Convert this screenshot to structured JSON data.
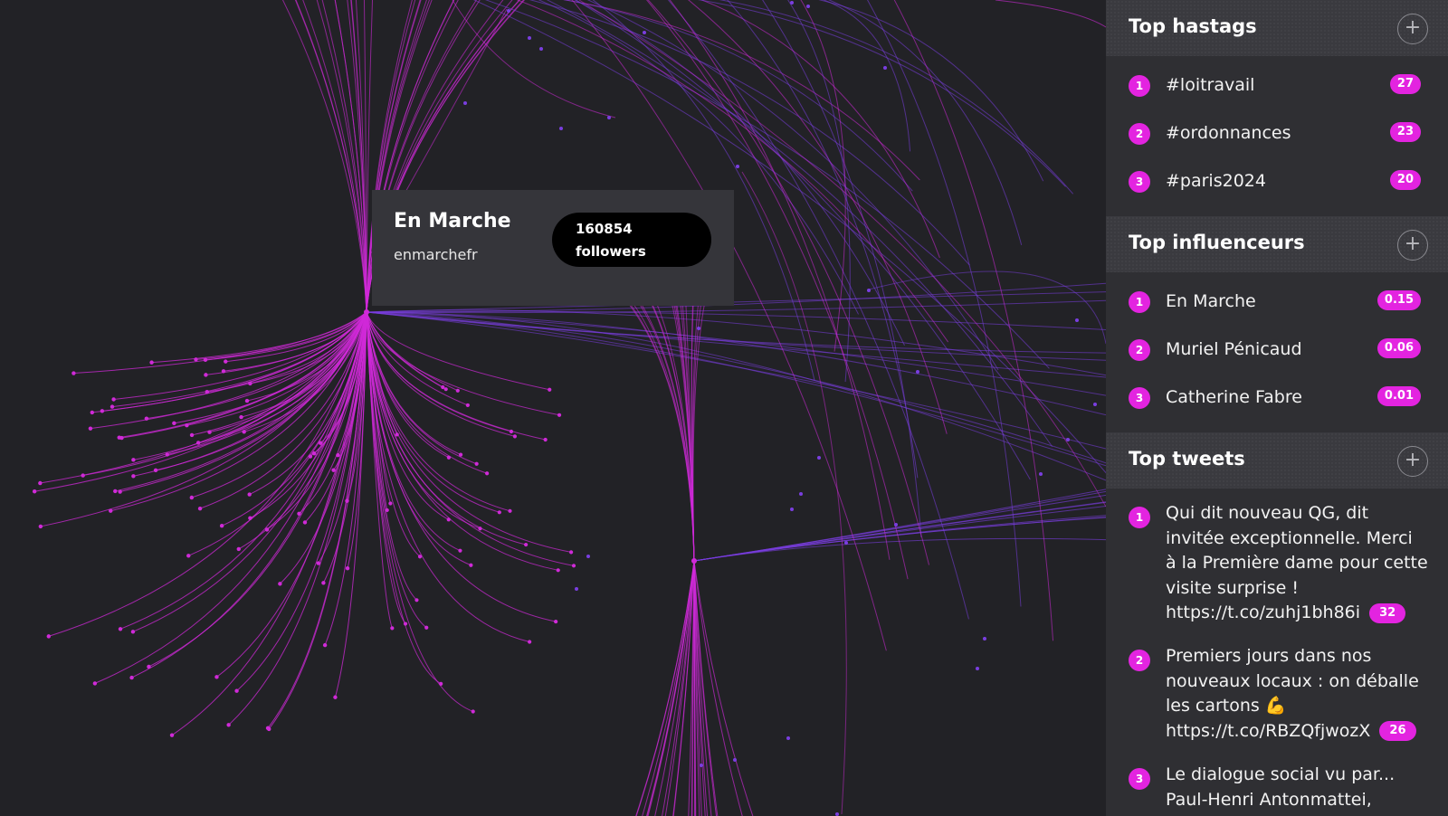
{
  "tooltip": {
    "name": "En Marche",
    "handle": "enmarchefr",
    "followers_count": "160854",
    "followers_label": "followers"
  },
  "hashtags": {
    "title": "Top hastags",
    "add_icon": "plus-icon",
    "items": [
      {
        "rank": "1",
        "label": "#loitravail",
        "count": "27"
      },
      {
        "rank": "2",
        "label": "#ordonnances",
        "count": "23"
      },
      {
        "rank": "3",
        "label": "#paris2024",
        "count": "20"
      }
    ]
  },
  "influencers": {
    "title": "Top influenceurs",
    "add_icon": "plus-icon",
    "items": [
      {
        "rank": "1",
        "label": "En Marche",
        "score": "0.15"
      },
      {
        "rank": "2",
        "label": "Muriel Pénicaud",
        "score": "0.06"
      },
      {
        "rank": "3",
        "label": "Catherine Fabre",
        "score": "0.01"
      }
    ]
  },
  "tweets": {
    "title": "Top tweets",
    "add_icon": "plus-icon",
    "items": [
      {
        "rank": "1",
        "text": "Qui dit nouveau QG, dit invitée exceptionnelle. Merci à la Première dame pour cette visite surprise ! https://t.co/zuhj1bh86i",
        "count": "32"
      },
      {
        "rank": "2",
        "text": "Premiers jours dans nos nouveaux locaux : on déballe les cartons 💪 https://t.co/RBZQfjwozX",
        "count": "26"
      },
      {
        "rank": "3",
        "text": "Le dialogue social vu par... Paul-Henri Antonmattei, avocat et",
        "count": ""
      }
    ]
  },
  "colors": {
    "background": "#222226",
    "sidebar": "#2f2f33",
    "accent": "#e324e0",
    "edge_purple": "#7a3ee0",
    "edge_magenta": "#d02ad8"
  }
}
